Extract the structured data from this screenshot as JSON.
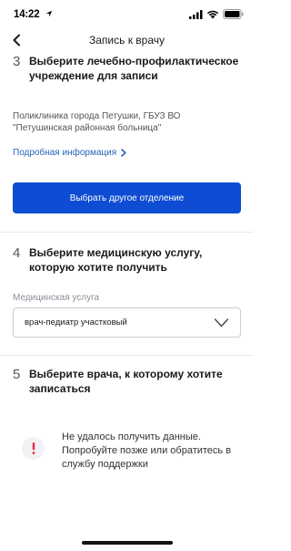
{
  "status_bar": {
    "time": "14:22",
    "icons": [
      "location-arrow-icon",
      "signal-icon",
      "wifi-icon",
      "battery-icon"
    ]
  },
  "nav": {
    "title": "Запись к врачу",
    "back_icon": "chevron-left-icon"
  },
  "step3": {
    "number": "3",
    "title": "Выберите лечебно-профилактическое учреждение для записи",
    "clinic_name": "Поликлиника города Петушки, ГБУЗ ВО \"Петушинская районная больница\"",
    "more_link": "Подробная информация",
    "button_label": "Выбрать другое отделение"
  },
  "step4": {
    "number": "4",
    "title": "Выберите медицинскую услугу, которую хотите получить",
    "field_label": "Медицинская услуга",
    "selected_value": "врач-педиатр участковый"
  },
  "step5": {
    "number": "5",
    "title": "Выберите врача, к которому хотите записаться",
    "error_message": "Не удалось получить данные. Попробуйте позже или обратитесь в службу поддержки"
  },
  "colors": {
    "primary": "#0d4cd3",
    "link": "#2764b8",
    "error": "#e0304a"
  }
}
